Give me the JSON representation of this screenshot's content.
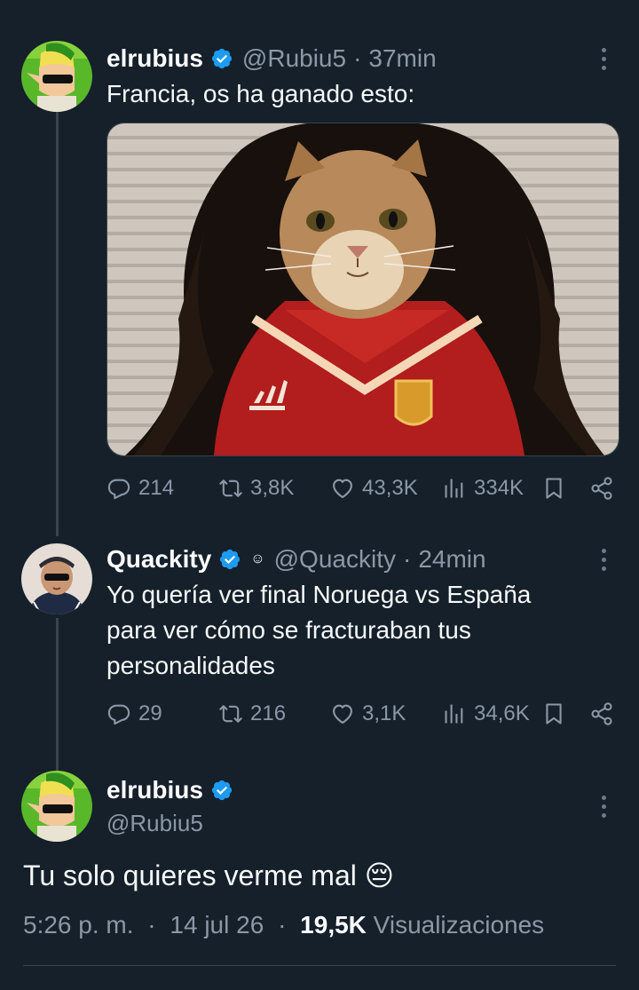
{
  "tweets": [
    {
      "name": "elrubius",
      "handle": "@Rubiu5",
      "time": "37min",
      "text": "Francia, os ha ganado esto:",
      "stats": {
        "replies": "214",
        "retweets": "3,8K",
        "likes": "43,3K",
        "views": "334K"
      }
    },
    {
      "name": "Quackity",
      "handle": "@Quackity",
      "time": "24min",
      "text_lines": [
        "Yo quería ver final Noruega vs España",
        "para ver cómo se fracturaban tus",
        "personalidades"
      ],
      "stats": {
        "replies": "29",
        "retweets": "216",
        "likes": "3,1K",
        "views": "34,6K"
      }
    }
  ],
  "main_tweet": {
    "name": "elrubius",
    "handle": "@Rubiu5",
    "text": "Tu solo quieres verme mal",
    "emoji": "😔",
    "time": "5:26 p. m.",
    "date": "14 jul 26",
    "views_count": "19,5K",
    "views_label": "Visualizaciones"
  },
  "colors": {
    "background": "#15202b",
    "secondary_text": "#8b98a5",
    "verified": "#1d9bf0",
    "divider": "#38444d"
  },
  "icons": [
    "reply-icon",
    "retweet-icon",
    "like-icon",
    "views-icon",
    "bookmark-icon",
    "share-icon",
    "verified-icon",
    "more-icon"
  ]
}
